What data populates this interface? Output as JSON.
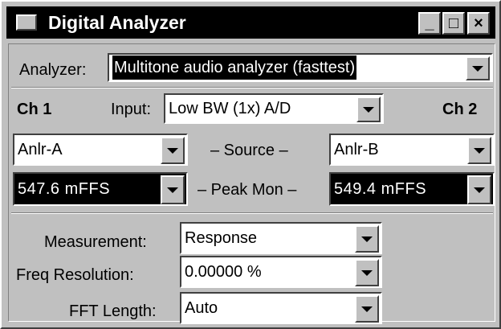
{
  "window": {
    "title": "Digital Analyzer",
    "controls": {
      "minimize": "_",
      "maximize": "□",
      "close": "×"
    }
  },
  "analyzer": {
    "label": "Analyzer:",
    "value": "Multitone audio analyzer (fasttest)"
  },
  "channels": {
    "ch1_label": "Ch 1",
    "ch2_label": "Ch 2"
  },
  "input": {
    "label": "Input:",
    "value": "Low BW (1x) A/D"
  },
  "source": {
    "label": "– Source –",
    "ch1": "Anlr-A",
    "ch2": "Anlr-B"
  },
  "peak_mon": {
    "label": "– Peak Mon –",
    "ch1": "547.6  mFFS",
    "ch2": "549.4  mFFS"
  },
  "settings": {
    "measurement": {
      "label": "Measurement:",
      "value": "Response"
    },
    "freq_resolution": {
      "label": "Freq Resolution:",
      "value": "0.00000  %"
    },
    "fft_length": {
      "label": "FFT Length:",
      "value": "Auto"
    }
  },
  "icons": [
    "window-menu-icon",
    "minimize-icon",
    "maximize-icon",
    "close-icon",
    "dropdown-arrow-icon"
  ]
}
